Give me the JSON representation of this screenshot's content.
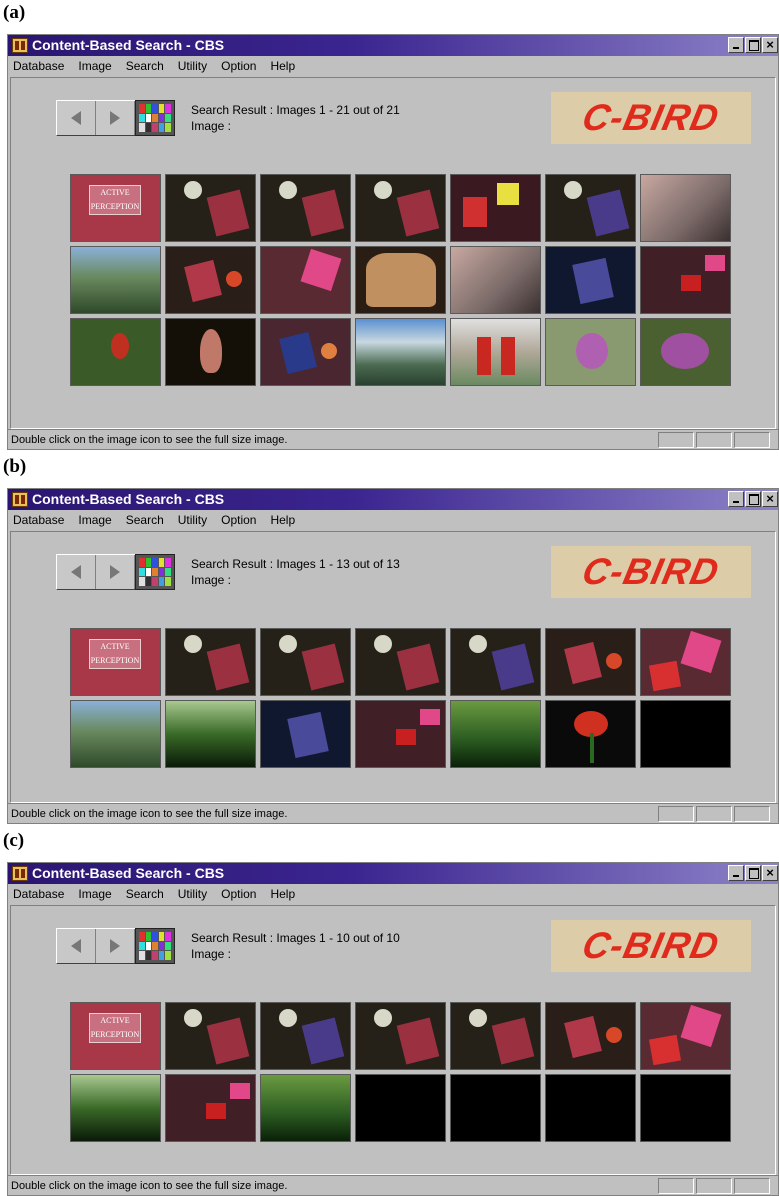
{
  "panels": [
    {
      "label": "(a)",
      "window": {
        "title": "Content-Based Search - CBS",
        "close_glyph": "×",
        "menus": [
          "Database",
          "Image",
          "Search",
          "Utility",
          "Option",
          "Help"
        ],
        "result_text": "Search Result :  Images 1 - 21 out of 21",
        "image_text": "Image :",
        "logo_text": "C-BIRD",
        "status_text": "Double click on the image icon to see the full size image."
      }
    },
    {
      "label": "(b)",
      "window": {
        "title": "Content-Based Search - CBS",
        "close_glyph": "×",
        "menus": [
          "Database",
          "Image",
          "Search",
          "Utility",
          "Option",
          "Help"
        ],
        "result_text": "Search Result :  Images 1 - 13 out of 13",
        "image_text": "Image :",
        "logo_text": "C-BIRD",
        "status_text": "Double click on the image icon to see the full size image."
      }
    },
    {
      "label": "(c)",
      "window": {
        "title": "Content-Based Search - CBS",
        "close_glyph": "×",
        "menus": [
          "Database",
          "Image",
          "Search",
          "Utility",
          "Option",
          "Help"
        ],
        "result_text": "Search Result :  Images 1 - 10 out of 10",
        "image_text": "Image :",
        "logo_text": "C-BIRD",
        "status_text": "Double click on the image icon to see the full size image."
      }
    }
  ],
  "book_cover": {
    "line1": "ACTIVE",
    "line2": "PERCEPTION"
  },
  "colors": {
    "titlebar_start": "#2a1670",
    "titlebar_end": "#8d82c8",
    "window_face": "#c0c0c0",
    "logo_bg": "#dccca8",
    "logo_text": "#e02a1c"
  },
  "icons": {
    "app": "cbs-app-icon",
    "prev": "left-arrow-icon",
    "next": "right-arrow-icon",
    "palette": "color-palette-icon"
  }
}
